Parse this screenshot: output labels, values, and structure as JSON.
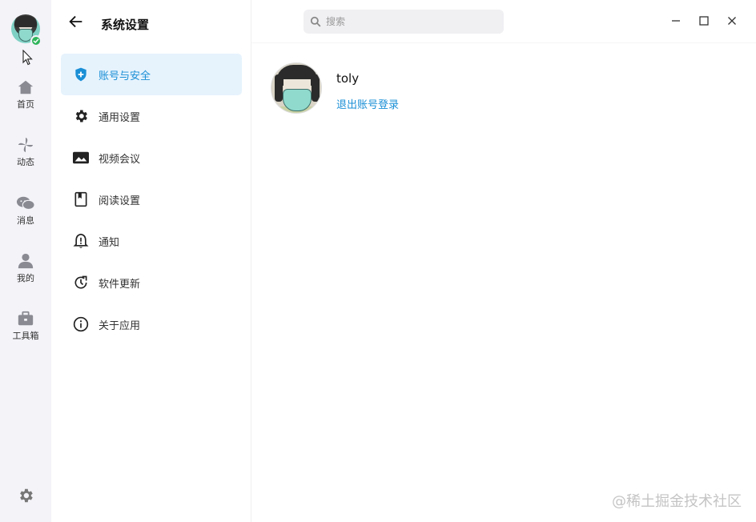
{
  "header": {
    "title": "系统设置",
    "search_placeholder": "搜索"
  },
  "rail": {
    "items": [
      {
        "label": "首页",
        "icon": "home-icon"
      },
      {
        "label": "动态",
        "icon": "pinwheel-icon"
      },
      {
        "label": "消息",
        "icon": "chat-icon"
      },
      {
        "label": "我的",
        "icon": "user-icon"
      },
      {
        "label": "工具箱",
        "icon": "toolbox-icon"
      }
    ],
    "settings_icon": "gear-icon"
  },
  "nav": {
    "items": [
      {
        "label": "账号与安全",
        "icon": "shield-plus-icon",
        "active": true
      },
      {
        "label": "通用设置",
        "icon": "gear-icon"
      },
      {
        "label": "视频会议",
        "icon": "video-icon"
      },
      {
        "label": "阅读设置",
        "icon": "book-icon"
      },
      {
        "label": "通知",
        "icon": "bell-alert-icon"
      },
      {
        "label": "软件更新",
        "icon": "update-icon"
      },
      {
        "label": "关于应用",
        "icon": "info-icon"
      }
    ]
  },
  "profile": {
    "username": "toly",
    "logout_label": "退出账号登录"
  },
  "watermark": "@稀土掘金技术社区",
  "colors": {
    "accent": "#1a8fd6",
    "active_bg": "#e6f3fd",
    "online": "#2fb45a",
    "rail_bg": "#f3f3f8"
  }
}
